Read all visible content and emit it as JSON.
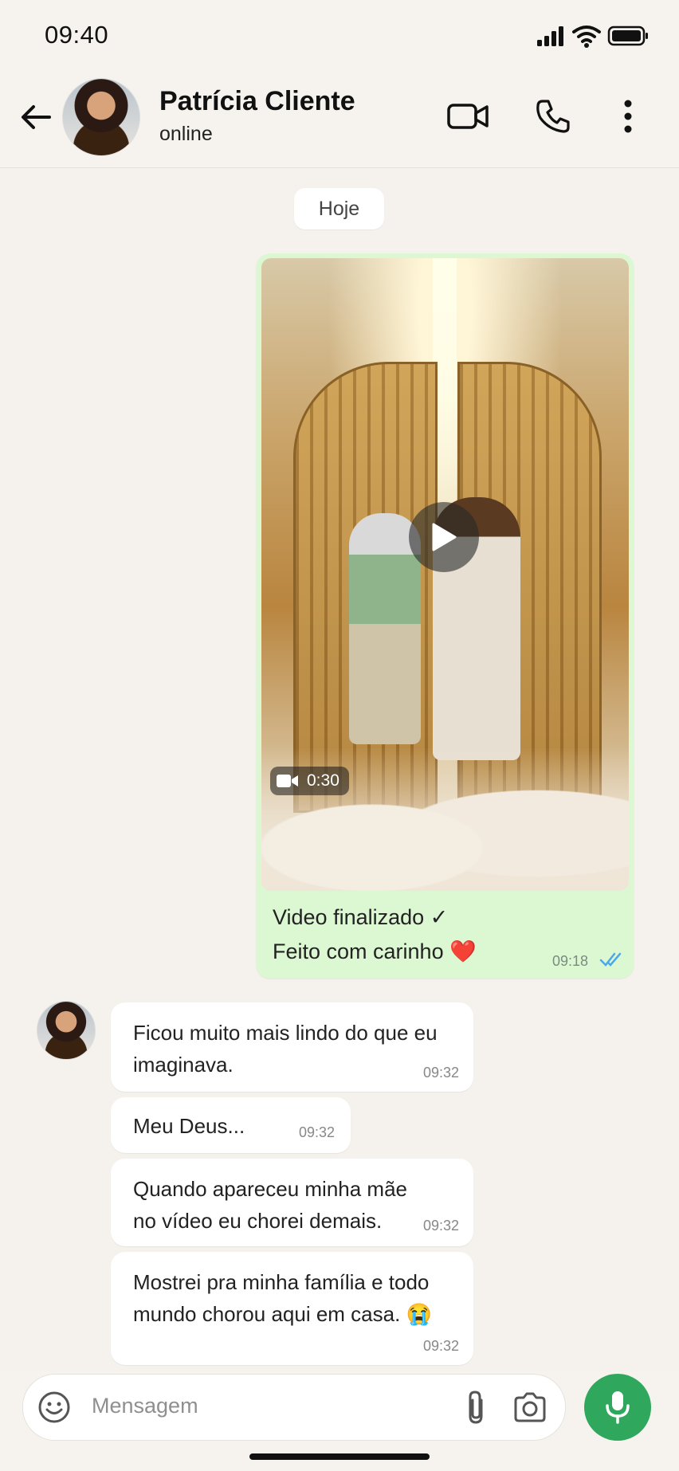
{
  "status_bar": {
    "time": "09:40"
  },
  "contact": {
    "name": "Patrícia Cliente",
    "status": "online"
  },
  "icons": {
    "back": "arrow-left-icon",
    "video_call": "video-camera-icon",
    "voice_call": "phone-icon",
    "more": "more-vertical-icon",
    "play": "play-icon",
    "video_badge": "video-camera-icon",
    "double_check": "double-check-icon",
    "emoji": "emoji-icon",
    "attach": "paperclip-icon",
    "camera": "camera-icon",
    "mic": "microphone-icon"
  },
  "date_chip": "Hoje",
  "outgoing": {
    "video_duration": "0:30",
    "line1": "Video finalizado ✓",
    "line2": "Feito com carinho ❤️",
    "time": "09:18"
  },
  "incoming": [
    {
      "text": "Ficou muito mais lindo do que eu imaginava.",
      "time": "09:32"
    },
    {
      "text": "Meu Deus...",
      "time": "09:32"
    },
    {
      "text": "Quando apareceu minha mãe no vídeo eu chorei demais.",
      "time": "09:32"
    },
    {
      "text": "Mostrei pra minha família e todo mundo chorou aqui em casa. 😭",
      "time": "09:32"
    }
  ],
  "composer": {
    "placeholder": "Mensagem"
  },
  "colors": {
    "accent": "#2fa75d",
    "outgoing_bubble": "#dcf8d3",
    "chat_bg": "#f5f2ed",
    "read_tick": "#4fa8e6"
  }
}
